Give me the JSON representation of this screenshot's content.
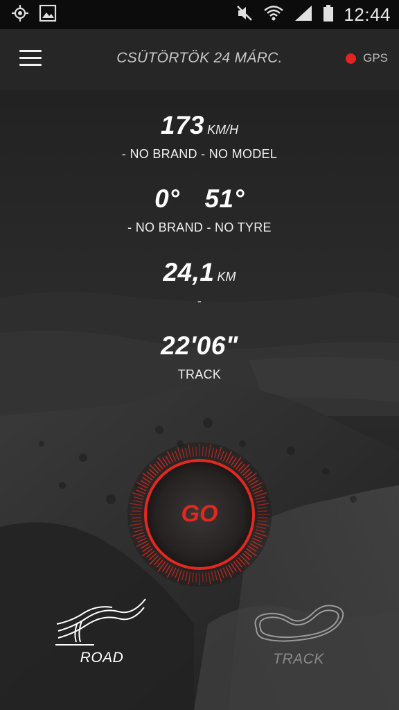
{
  "status_bar": {
    "time": "12:44",
    "icons": [
      "location-target-icon",
      "gallery-icon",
      "mute-icon",
      "wifi-icon",
      "signal-icon",
      "battery-icon"
    ]
  },
  "app_bar": {
    "title": "CSÜTÖRTÖK 24 MÁRC.",
    "gps_label": "GPS",
    "gps_status_color": "#e02424"
  },
  "stats": {
    "speed": {
      "value": "173",
      "unit": "KM/H",
      "sub": "- NO BRAND - NO MODEL"
    },
    "angles": {
      "left": "0°",
      "right": "51°",
      "sub": "- NO BRAND - NO TYRE"
    },
    "distance": {
      "value": "24,1",
      "unit": "KM",
      "sub": "-"
    },
    "time": {
      "value": "22'06\"",
      "sub": "TRACK"
    }
  },
  "go_button": {
    "label": "GO",
    "accent": "#e3281f"
  },
  "modes": {
    "road": {
      "label": "ROAD",
      "selected": true
    },
    "track": {
      "label": "TRACK",
      "selected": false
    }
  }
}
